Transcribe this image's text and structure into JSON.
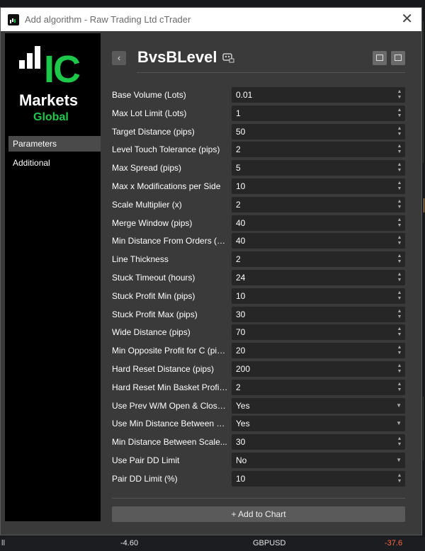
{
  "window": {
    "title": "Add algorithm - Raw Trading Ltd cTrader",
    "close_glyph": "✕"
  },
  "logo": {
    "ic": "IC",
    "markets": "Markets",
    "global": "Global"
  },
  "sidebar": {
    "items": [
      {
        "label": "Parameters",
        "active": true
      },
      {
        "label": "Additional",
        "active": false
      }
    ]
  },
  "header": {
    "back_glyph": "‹",
    "algo_name": "BvsBLevel"
  },
  "params": [
    {
      "label": "Base Volume (Lots)",
      "value": "0.01",
      "type": "number"
    },
    {
      "label": "Max Lot Limit (Lots)",
      "value": "1",
      "type": "number"
    },
    {
      "label": "Target Distance (pips)",
      "value": "50",
      "type": "number"
    },
    {
      "label": "Level Touch Tolerance (pips)",
      "value": "2",
      "type": "number"
    },
    {
      "label": "Max Spread (pips)",
      "value": "5",
      "type": "number"
    },
    {
      "label": "Max x Modifications per Side",
      "value": "10",
      "type": "number"
    },
    {
      "label": "Scale Multiplier (x)",
      "value": "2",
      "type": "number"
    },
    {
      "label": "Merge Window (pips)",
      "value": "40",
      "type": "number"
    },
    {
      "label": "Min Distance From Orders (pi...",
      "value": "40",
      "type": "number"
    },
    {
      "label": "Line Thickness",
      "value": "2",
      "type": "number"
    },
    {
      "label": "Stuck Timeout (hours)",
      "value": "24",
      "type": "number"
    },
    {
      "label": "Stuck Profit Min (pips)",
      "value": "10",
      "type": "number"
    },
    {
      "label": "Stuck Profit Max (pips)",
      "value": "30",
      "type": "number"
    },
    {
      "label": "Wide Distance (pips)",
      "value": "70",
      "type": "number"
    },
    {
      "label": "Min Opposite Profit for C (pips)",
      "value": "20",
      "type": "number"
    },
    {
      "label": "Hard Reset Distance (pips)",
      "value": "200",
      "type": "number"
    },
    {
      "label": "Hard Reset Min Basket Profit...",
      "value": "2",
      "type": "number"
    },
    {
      "label": "Use Prev W/M Open & Close...",
      "value": "Yes",
      "type": "select"
    },
    {
      "label": "Use Min Distance Between S...",
      "value": "Yes",
      "type": "select"
    },
    {
      "label": "Min Distance Between Scale...",
      "value": "30",
      "type": "number"
    },
    {
      "label": "Use Pair DD Limit",
      "value": "No",
      "type": "select"
    },
    {
      "label": "Pair DD Limit (%)",
      "value": "10",
      "type": "number"
    }
  ],
  "add_button": {
    "label": "Add to Chart",
    "icon": "+"
  },
  "status_bar": {
    "left": "ll",
    "value1": "-4.60",
    "symbol": "GBPUSD",
    "value2": "-37.6"
  },
  "colors": {
    "brand_green": "#1dc74a",
    "negative": "#ff6a3d"
  }
}
